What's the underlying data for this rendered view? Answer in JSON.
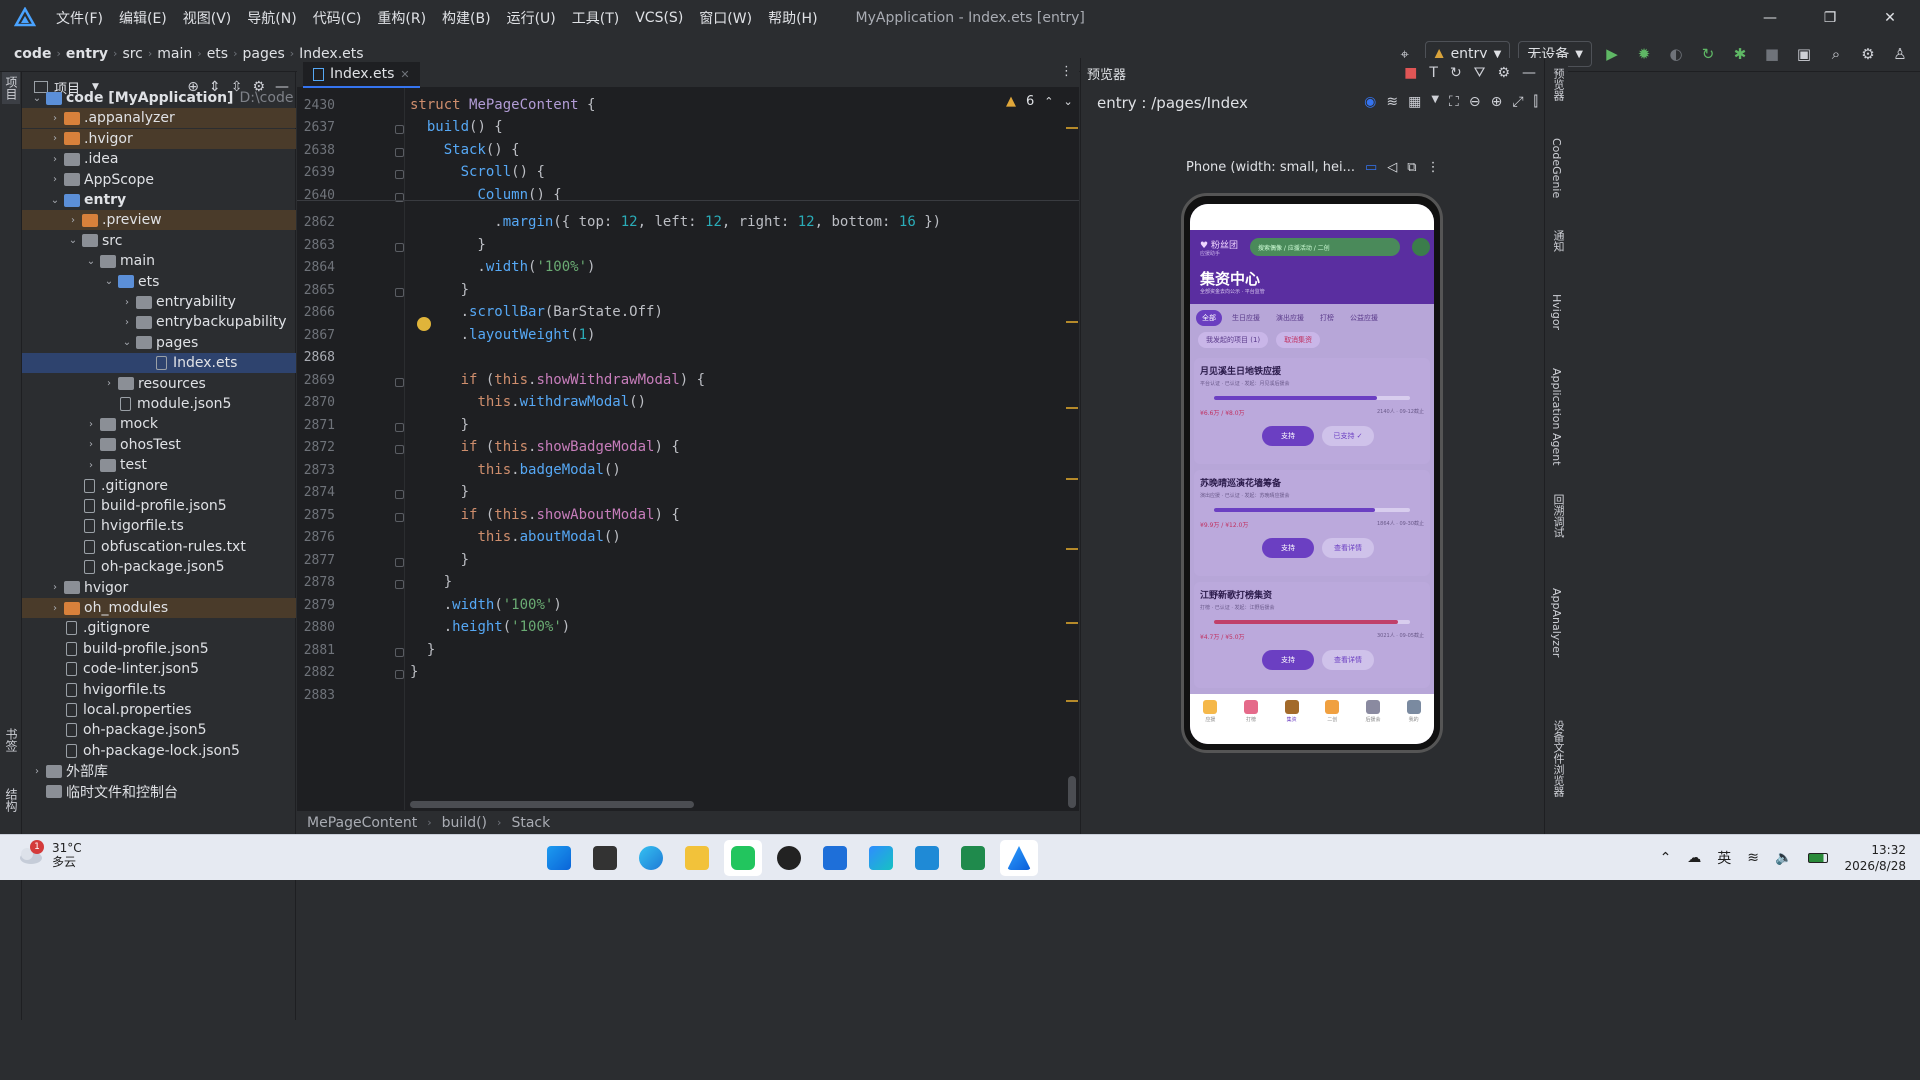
{
  "menu": [
    "文件(F)",
    "编辑(E)",
    "视图(V)",
    "导航(N)",
    "代码(C)",
    "重构(R)",
    "构建(B)",
    "运行(U)",
    "工具(T)",
    "VCS(S)",
    "窗口(W)",
    "帮助(H)"
  ],
  "window_title": "MyApplication - Index.ets [entry]",
  "breadcrumbs": [
    "code",
    "entry",
    "src",
    "main",
    "ets",
    "pages",
    "Index.ets"
  ],
  "run_config": "entry",
  "device": "无设备",
  "left_strip": {
    "top": "项目",
    "bottom1": "书签",
    "bottom2": "结构"
  },
  "project": {
    "title": "项目",
    "tree": [
      {
        "label": "code [MyApplication]",
        "hint": "D:\\code",
        "indent": 0,
        "arrow": "v",
        "icon": "fold b",
        "bold": true
      },
      {
        "label": ".appanalyzer",
        "indent": 1,
        "arrow": ">",
        "icon": "fold o",
        "hl": true
      },
      {
        "label": ".hvigor",
        "indent": 1,
        "arrow": ">",
        "icon": "fold o",
        "hl": true
      },
      {
        "label": ".idea",
        "indent": 1,
        "arrow": ">",
        "icon": "fold"
      },
      {
        "label": "AppScope",
        "indent": 1,
        "arrow": ">",
        "icon": "fold"
      },
      {
        "label": "entry",
        "indent": 1,
        "arrow": "v",
        "icon": "fold b",
        "bold": true
      },
      {
        "label": ".preview",
        "indent": 2,
        "arrow": ">",
        "icon": "fold o",
        "hl": true
      },
      {
        "label": "src",
        "indent": 2,
        "arrow": "v",
        "icon": "fold"
      },
      {
        "label": "main",
        "indent": 3,
        "arrow": "v",
        "icon": "fold"
      },
      {
        "label": "ets",
        "indent": 4,
        "arrow": "v",
        "icon": "fold b"
      },
      {
        "label": "entryability",
        "indent": 5,
        "arrow": ">",
        "icon": "fold"
      },
      {
        "label": "entrybackupability",
        "indent": 5,
        "arrow": ">",
        "icon": "fold"
      },
      {
        "label": "pages",
        "indent": 5,
        "arrow": "v",
        "icon": "fold"
      },
      {
        "label": "Index.ets",
        "indent": 6,
        "arrow": "",
        "icon": "file",
        "sel": true
      },
      {
        "label": "resources",
        "indent": 4,
        "arrow": ">",
        "icon": "fold"
      },
      {
        "label": "module.json5",
        "indent": 4,
        "arrow": "",
        "icon": "file"
      },
      {
        "label": "mock",
        "indent": 3,
        "arrow": ">",
        "icon": "fold"
      },
      {
        "label": "ohosTest",
        "indent": 3,
        "arrow": ">",
        "icon": "fold"
      },
      {
        "label": "test",
        "indent": 3,
        "arrow": ">",
        "icon": "fold"
      },
      {
        "label": ".gitignore",
        "indent": 2,
        "arrow": "",
        "icon": "file"
      },
      {
        "label": "build-profile.json5",
        "indent": 2,
        "arrow": "",
        "icon": "file"
      },
      {
        "label": "hvigorfile.ts",
        "indent": 2,
        "arrow": "",
        "icon": "file"
      },
      {
        "label": "obfuscation-rules.txt",
        "indent": 2,
        "arrow": "",
        "icon": "file"
      },
      {
        "label": "oh-package.json5",
        "indent": 2,
        "arrow": "",
        "icon": "file"
      },
      {
        "label": "hvigor",
        "indent": 1,
        "arrow": ">",
        "icon": "fold"
      },
      {
        "label": "oh_modules",
        "indent": 1,
        "arrow": ">",
        "icon": "fold o",
        "hl": true
      },
      {
        "label": ".gitignore",
        "indent": 1,
        "arrow": "",
        "icon": "file"
      },
      {
        "label": "build-profile.json5",
        "indent": 1,
        "arrow": "",
        "icon": "file"
      },
      {
        "label": "code-linter.json5",
        "indent": 1,
        "arrow": "",
        "icon": "file"
      },
      {
        "label": "hvigorfile.ts",
        "indent": 1,
        "arrow": "",
        "icon": "file"
      },
      {
        "label": "local.properties",
        "indent": 1,
        "arrow": "",
        "icon": "file"
      },
      {
        "label": "oh-package.json5",
        "indent": 1,
        "arrow": "",
        "icon": "file"
      },
      {
        "label": "oh-package-lock.json5",
        "indent": 1,
        "arrow": "",
        "icon": "file"
      },
      {
        "label": "外部库",
        "indent": 0,
        "arrow": ">",
        "icon": "fold"
      },
      {
        "label": "临时文件和控制台",
        "indent": 0,
        "arrow": "",
        "icon": "fold"
      }
    ]
  },
  "editor": {
    "tab": "Index.ets",
    "warnings": "6",
    "lines": [
      {
        "n": "2430",
        "html": "<span class='kw'>struct</span> <span class='ty'>MePageContent</span> {"
      },
      {
        "n": "2637",
        "html": "  <span class='fn'>build</span>() {"
      },
      {
        "n": "2638",
        "html": "    <span class='fn'>Stack</span>() {"
      },
      {
        "n": "2639",
        "html": "      <span class='fn'>Scroll</span>() {"
      },
      {
        "n": "2640",
        "html": "        <span class='fn'>Column</span>() {"
      },
      {
        "n": "2862",
        "html": "          .<span class='fn'>margin</span>({ top: <span class='nm'>12</span>, left: <span class='nm'>12</span>, right: <span class='nm'>12</span>, bottom: <span class='nm'>16</span> })"
      },
      {
        "n": "2863",
        "html": "        }"
      },
      {
        "n": "2864",
        "html": "        .<span class='fn'>width</span>(<span class='st'>'100%'</span>)"
      },
      {
        "n": "2865",
        "html": "      }"
      },
      {
        "n": "2866",
        "html": "      .<span class='fn'>scrollBar</span>(BarState.Off)"
      },
      {
        "n": "2867",
        "html": "      .<span class='fn'>layoutWeight</span>(<span class='nm'>1</span>)"
      },
      {
        "n": "2868",
        "html": ""
      },
      {
        "n": "2869",
        "html": "      <span class='kw'>if</span> (<span class='kw'>this</span>.<span class='me'>showWithdrawModal</span>) {"
      },
      {
        "n": "2870",
        "html": "        <span class='kw'>this</span>.<span class='fn'>withdrawModal</span>()"
      },
      {
        "n": "2871",
        "html": "      }"
      },
      {
        "n": "2872",
        "html": "      <span class='kw'>if</span> (<span class='kw'>this</span>.<span class='me'>showBadgeModal</span>) {"
      },
      {
        "n": "2873",
        "html": "        <span class='kw'>this</span>.<span class='fn'>badgeModal</span>()"
      },
      {
        "n": "2874",
        "html": "      }"
      },
      {
        "n": "2875",
        "html": "      <span class='kw'>if</span> (<span class='kw'>this</span>.<span class='me'>showAboutModal</span>) {"
      },
      {
        "n": "2876",
        "html": "        <span class='kw'>this</span>.<span class='fn'>aboutModal</span>()"
      },
      {
        "n": "2877",
        "html": "      }"
      },
      {
        "n": "2878",
        "html": "    }"
      },
      {
        "n": "2879",
        "html": "    .<span class='fn'>width</span>(<span class='st'>'100%'</span>)"
      },
      {
        "n": "2880",
        "html": "    .<span class='fn'>height</span>(<span class='st'>'100%'</span>)"
      },
      {
        "n": "2881",
        "html": "  }"
      },
      {
        "n": "2882",
        "html": "}"
      },
      {
        "n": "2883",
        "html": ""
      }
    ],
    "breadcrumb": [
      "MePageContent",
      "build()",
      "Stack"
    ]
  },
  "previewer": {
    "title": "预览器",
    "path": "entry : /pages/Index",
    "device_label": "Phone (width: small, hei...",
    "app": {
      "brand": "粉丝团",
      "brand_sub": "应援助手",
      "search": "搜索偶像 / 应援活动 / 二创",
      "title": "集资中心",
      "subtitle": "全部资金去向公示 · 平台监管",
      "tabs": [
        "全部",
        "生日应援",
        "演出应援",
        "打榜",
        "公益应援"
      ],
      "chips": [
        "我发起的项目 (1)",
        "取消集资"
      ],
      "cards": [
        {
          "title": "月见溪生日地铁应援",
          "tags": "平台认证 · 已认证 · 发起：月见溪后援会",
          "amount": "¥6.6万 / ¥8.0万",
          "meta": "2140人 · 09-12截止",
          "progress": 0.83,
          "b1": "支持",
          "b2": "已支持 ✓"
        },
        {
          "title": "苏晚晴巡演花墙筹备",
          "tags": "演出应援 · 已认证 · 发起：苏晚晴应援会",
          "amount": "¥9.9万 / ¥12.0万",
          "meta": "1864人 · 09-30截止",
          "progress": 0.82,
          "b1": "支持",
          "b2": "查看详情"
        },
        {
          "title": "江野新歌打榜集资",
          "tags": "打榜 · 已认证 · 发起：江野后援会",
          "amount": "¥4.7万 / ¥5.0万",
          "meta": "3021人 · 09-05截止",
          "progress": 0.94,
          "b1": "支持",
          "b2": "查看详情"
        }
      ],
      "nav": [
        "应援",
        "打榜",
        "集资",
        "二创",
        "后援会",
        "我的"
      ]
    }
  },
  "right_strip": [
    "预览器",
    "CodeGenie",
    "通知",
    "Hvigor",
    "Application Agent",
    "回溯调试",
    "AppAnalyzer",
    "设备文件浏览器"
  ],
  "taskbar": {
    "weather_temp": "31°C",
    "weather_desc": "多云",
    "weather_badge": "1",
    "ime": "英",
    "time": "13:32",
    "date": "2026/8/28"
  }
}
